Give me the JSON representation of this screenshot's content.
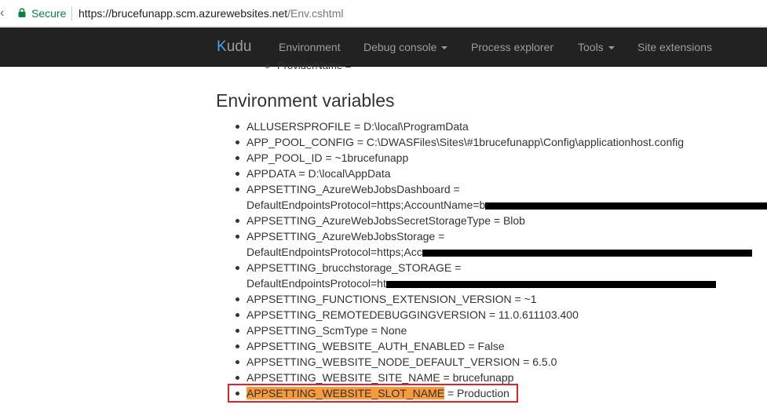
{
  "browser": {
    "secure_label": "Secure",
    "url_base": "https://brucefunapp.scm.azurewebsites.net",
    "url_path": "/Env.cshtml"
  },
  "navbar": {
    "brand_k": "K",
    "brand_rest": "udu",
    "items": [
      {
        "label": "Environment"
      },
      {
        "label": "Debug console"
      },
      {
        "label": "Process explorer"
      },
      {
        "label": "Tools"
      },
      {
        "label": "Site extensions"
      }
    ]
  },
  "content": {
    "cut_item": "ProviderName =",
    "section_title": "Environment variables",
    "env_vars": [
      {
        "line1": "ALLUSERSPROFILE = D:\\local\\ProgramData"
      },
      {
        "line1": "APP_POOL_CONFIG = C:\\DWASFiles\\Sites\\#1brucefunapp\\Config\\applicationhost.config"
      },
      {
        "line1": "APP_POOL_ID = ~1brucefunapp"
      },
      {
        "line1": "APPDATA = D:\\local\\AppData"
      },
      {
        "line1": "APPSETTING_AzureWebJobsDashboard =",
        "line2": "DefaultEndpointsProtocol=https;AccountName=b"
      },
      {
        "line1": "APPSETTING_AzureWebJobsSecretStorageType = Blob"
      },
      {
        "line1": "APPSETTING_AzureWebJobsStorage =",
        "line2": "DefaultEndpointsProtocol=https;Acc"
      },
      {
        "line1": "APPSETTING_brucchstorage_STORAGE =",
        "line2": "DefaultEndpointsProtocol=ht"
      },
      {
        "line1": "APPSETTING_FUNCTIONS_EXTENSION_VERSION = ~1"
      },
      {
        "line1": "APPSETTING_REMOTEDEBUGGINGVERSION = 11.0.611103.400"
      },
      {
        "line1": "APPSETTING_ScmType = None"
      },
      {
        "line1": "APPSETTING_WEBSITE_AUTH_ENABLED = False"
      },
      {
        "line1": "APPSETTING_WEBSITE_NODE_DEFAULT_VERSION = 6.5.0"
      },
      {
        "line1": "APPSETTING_WEBSITE_SITE_NAME = brucefunapp"
      }
    ],
    "highlighted": {
      "name": "APPSETTING_WEBSITE_SLOT_NAME",
      "value": " = Production"
    }
  },
  "colors": {
    "navbar_bg": "#222222",
    "highlight_fill": "#f79a3c",
    "highlight_border": "#d9232d",
    "secure_green": "#0b8043"
  }
}
